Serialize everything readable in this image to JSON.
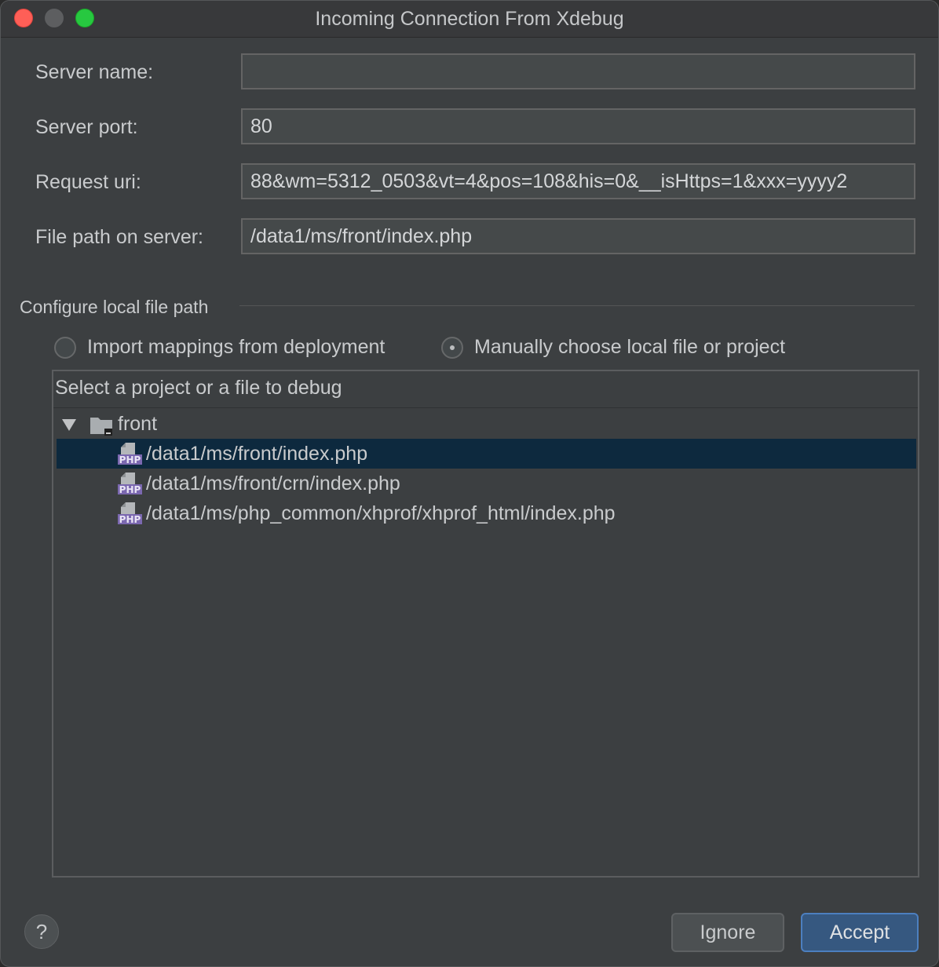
{
  "window": {
    "title": "Incoming Connection From Xdebug"
  },
  "fields": {
    "server_name": {
      "label": "Server name:",
      "value": ""
    },
    "server_port": {
      "label": "Server port:",
      "value": "80"
    },
    "request_uri": {
      "label": "Request uri:",
      "value": "88&wm=5312_0503&vt=4&pos=108&his=0&__isHttps=1&xxx=yyyy2"
    },
    "file_path": {
      "label": "File path on server:",
      "value": "/data1/ms/front/index.php"
    }
  },
  "configure": {
    "section_title": "Configure local file path",
    "options": [
      {
        "label": "Import mappings from deployment",
        "selected": false
      },
      {
        "label": "Manually choose local file or project",
        "selected": true
      }
    ]
  },
  "tree": {
    "header": "Select a project or a file to debug",
    "root": {
      "label": "front",
      "expanded": true,
      "icon": "folder-icon"
    },
    "items": [
      {
        "label": "/data1/ms/front/index.php",
        "selected": true,
        "icon": "php-file-icon"
      },
      {
        "label": "/data1/ms/front/crn/index.php",
        "selected": false,
        "icon": "php-file-icon"
      },
      {
        "label": "/data1/ms/php_common/xhprof/xhprof_html/index.php",
        "selected": false,
        "icon": "php-file-icon"
      }
    ]
  },
  "footer": {
    "help_label": "?",
    "ignore_label": "Ignore",
    "accept_label": "Accept"
  },
  "colors": {
    "background": "#3c3f41",
    "selection": "#0d293e",
    "accent_button": "#365880",
    "close": "#fe5f57",
    "maximize": "#27c840",
    "php_icon": "#8c7dbf"
  }
}
